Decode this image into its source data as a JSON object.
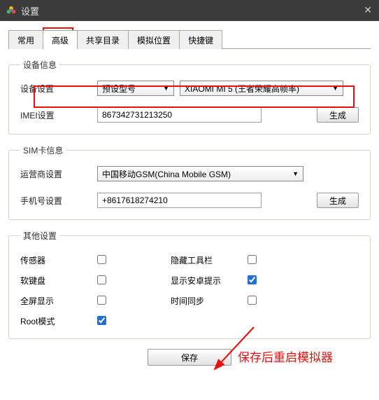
{
  "window": {
    "title": "设置"
  },
  "tabs": {
    "items": [
      "常用",
      "高级",
      "共享目录",
      "模拟位置",
      "快捷键"
    ],
    "active_index": 1
  },
  "device_info": {
    "legend": "设备信息",
    "row_device": {
      "label": "设备设置",
      "select1": "预设型号",
      "select2": "XIAOMI MI 5 (王者荣耀高帧率)"
    },
    "row_imei": {
      "label": "IMEI设置",
      "value": "867342731213250",
      "btn": "生成"
    }
  },
  "sim_info": {
    "legend": "SIM卡信息",
    "row_carrier": {
      "label": "运营商设置",
      "value": "中国移动GSM(China Mobile GSM)"
    },
    "row_phone": {
      "label": "手机号设置",
      "value": "+8617618274210",
      "btn": "生成"
    }
  },
  "other": {
    "legend": "其他设置",
    "opts": {
      "sensor": {
        "label": "传感器",
        "checked": false
      },
      "hide_toolbar": {
        "label": "隐藏工具栏",
        "checked": false
      },
      "soft_keyboard": {
        "label": "软键盘",
        "checked": false
      },
      "show_android_hint": {
        "label": "显示安卓提示",
        "checked": true
      },
      "fullscreen": {
        "label": "全屏显示",
        "checked": false
      },
      "time_sync": {
        "label": "时间同步",
        "checked": false
      },
      "root_mode": {
        "label": "Root模式",
        "checked": true
      }
    }
  },
  "save_btn": "保存",
  "annotation_note": "保存后重启模拟器",
  "colors": {
    "highlight_red": "#e81010",
    "titlebar_bg": "#3b3b3b"
  }
}
